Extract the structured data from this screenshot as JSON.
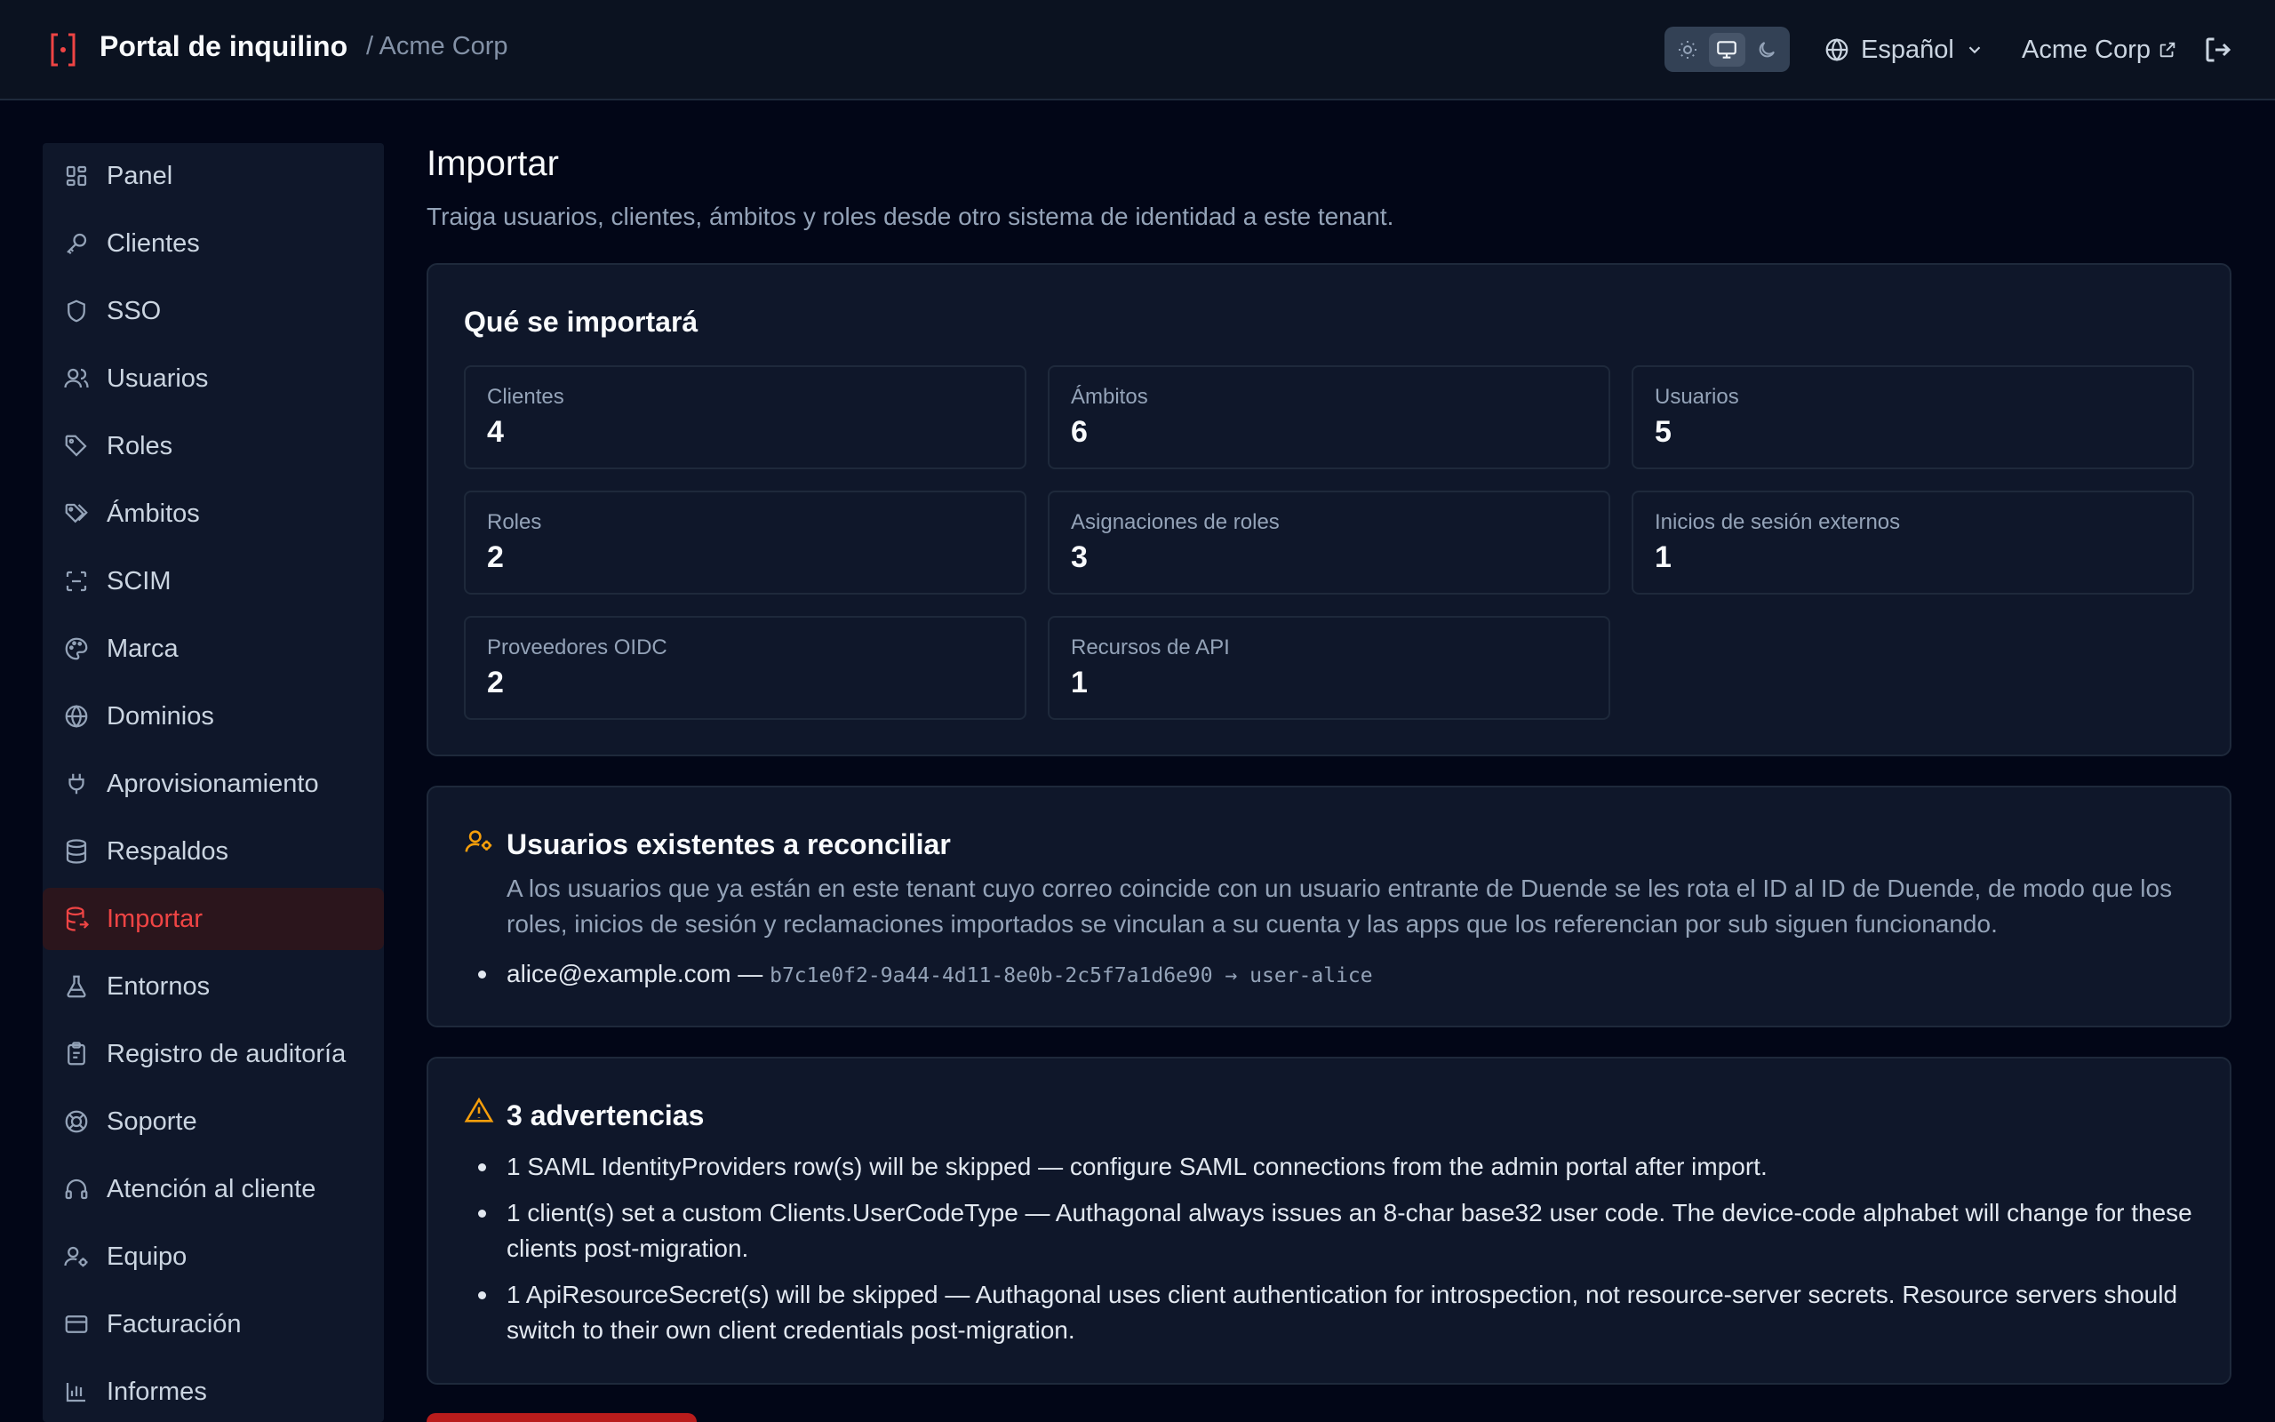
{
  "header": {
    "title": "Portal de inquilino",
    "crumb": "/ Acme Corp",
    "language": "Español",
    "tenant_link": "Acme Corp",
    "theme_modes": [
      "sun-icon",
      "monitor-icon",
      "moon-icon"
    ],
    "active_theme": "monitor-icon"
  },
  "colors": {
    "accent": "#ef4444",
    "background": "#020617",
    "panel": "#0f172a",
    "warning": "#f59e0b"
  },
  "sidebar": {
    "items": [
      {
        "label": "Panel",
        "icon": "dashboard-icon"
      },
      {
        "label": "Clientes",
        "icon": "key-icon"
      },
      {
        "label": "SSO",
        "icon": "shield-icon"
      },
      {
        "label": "Usuarios",
        "icon": "users-icon"
      },
      {
        "label": "Roles",
        "icon": "tag-icon"
      },
      {
        "label": "Ámbitos",
        "icon": "tags-icon"
      },
      {
        "label": "SCIM",
        "icon": "scan-icon"
      },
      {
        "label": "Marca",
        "icon": "palette-icon"
      },
      {
        "label": "Dominios",
        "icon": "globe-icon"
      },
      {
        "label": "Aprovisionamiento",
        "icon": "plug-icon"
      },
      {
        "label": "Respaldos",
        "icon": "database-icon"
      },
      {
        "label": "Importar",
        "icon": "database-import-icon",
        "active": true
      },
      {
        "label": "Entornos",
        "icon": "flask-icon"
      },
      {
        "label": "Registro de auditoría",
        "icon": "clipboard-icon"
      },
      {
        "label": "Soporte",
        "icon": "lifebuoy-icon"
      },
      {
        "label": "Atención al cliente",
        "icon": "headset-icon"
      },
      {
        "label": "Equipo",
        "icon": "user-cog-icon"
      },
      {
        "label": "Facturación",
        "icon": "card-icon"
      },
      {
        "label": "Informes",
        "icon": "bar-chart-icon"
      }
    ]
  },
  "main": {
    "title": "Importar",
    "subtitle": "Traiga usuarios, clientes, ámbitos y roles desde otro sistema de identidad a este tenant.",
    "summary": {
      "title": "Qué se importará",
      "stats": [
        {
          "label": "Clientes",
          "value": "4"
        },
        {
          "label": "Ámbitos",
          "value": "6"
        },
        {
          "label": "Usuarios",
          "value": "5"
        },
        {
          "label": "Roles",
          "value": "2"
        },
        {
          "label": "Asignaciones de roles",
          "value": "3"
        },
        {
          "label": "Inicios de sesión externos",
          "value": "1"
        },
        {
          "label": "Proveedores OIDC",
          "value": "2"
        },
        {
          "label": "Recursos de API",
          "value": "1"
        }
      ]
    },
    "reconcile": {
      "title": "Usuarios existentes a reconciliar",
      "description": "A los usuarios que ya están en este tenant cuyo correo coincide con un usuario entrante de Duende se les rota el ID al ID de Duende, de modo que los roles, inicios de sesión y reclamaciones importados se vinculan a su cuenta y las apps que los referencian por sub siguen funcionando.",
      "items": [
        {
          "email": "alice@example.com",
          "separator": " — ",
          "mapping": "b7c1e0f2-9a44-4d11-8e0b-2c5f7a1d6e90 → user-alice"
        }
      ]
    },
    "warnings": {
      "title": "3 advertencias",
      "items": [
        "1 SAML IdentityProviders row(s) will be skipped — configure SAML connections from the admin portal after import.",
        "1 client(s) set a custom Clients.UserCodeType — Authagonal always issues an 8-char base32 user code. The device-code alphabet will change for these clients post-migration.",
        "1 ApiResourceSecret(s) will be skipped — Authagonal uses client authentication for introspection, not resource-server secrets. Resource servers should switch to their own client credentials post-migration."
      ]
    }
  }
}
